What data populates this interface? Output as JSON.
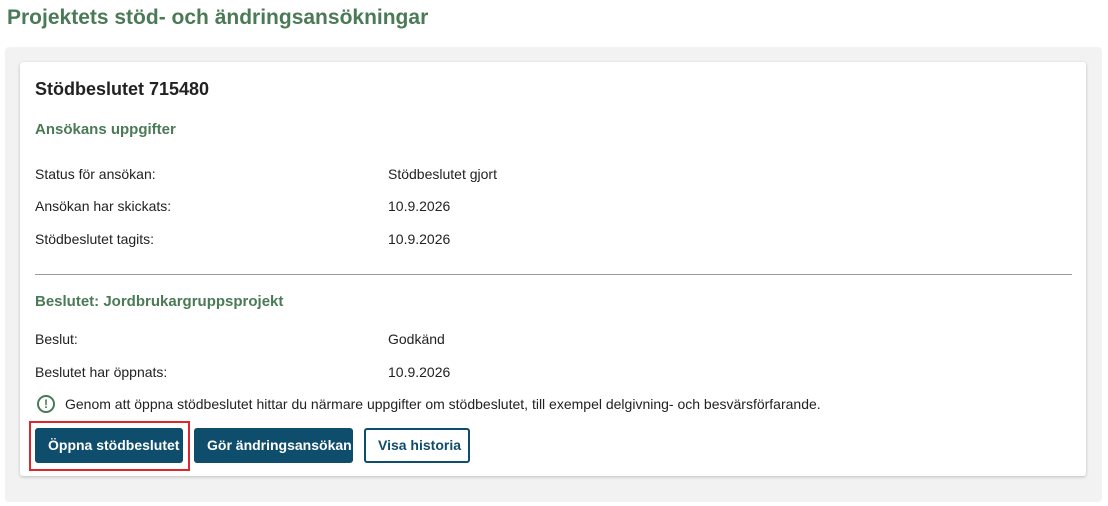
{
  "page": {
    "title": "Projektets stöd- och ändringsansökningar"
  },
  "card": {
    "title": "Stödbeslutet 715480",
    "application_section": {
      "title": "Ansökans uppgifter",
      "rows": [
        {
          "label": "Status för ansökan:",
          "value": "Stödbeslutet gjort"
        },
        {
          "label": "Ansökan har skickats:",
          "value": "10.9.2026"
        },
        {
          "label": "Stödbeslutet tagits:",
          "value": "10.9.2026"
        }
      ]
    },
    "decision_section": {
      "title": "Beslutet: Jordbrukargruppsprojekt",
      "rows": [
        {
          "label": "Beslut:",
          "value": "Godkänd"
        },
        {
          "label": "Beslutet har öppnats:",
          "value": "10.9.2026"
        }
      ]
    },
    "info": {
      "icon": "info-circle-icon",
      "icon_glyph": "!",
      "text": "Genom att öppna stödbeslutet hittar du närmare uppgifter om stödbeslutet, till exempel delgivning- och besvärsförfarande."
    },
    "buttons": {
      "open_decision": "Öppna stödbeslutet",
      "change_application": "Gör ändringsansökan",
      "show_history": "Visa historia"
    }
  },
  "colors": {
    "heading_green": "#4a7a56",
    "button_blue": "#0f4d6c",
    "highlight_red": "#e0262a"
  }
}
